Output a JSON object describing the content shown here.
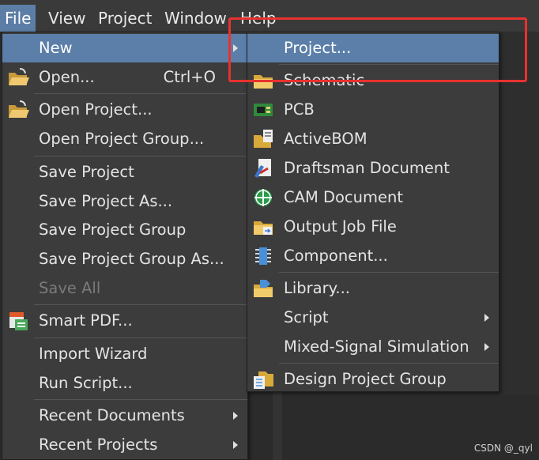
{
  "menubar": {
    "file": "File",
    "view": "View",
    "project": "Project",
    "window": "Window",
    "help": "Help"
  },
  "file_menu": {
    "new": "New",
    "open": "Open...",
    "open_shortcut": "Ctrl+O",
    "open_project": "Open Project...",
    "open_project_group": "Open Project Group...",
    "save_project": "Save Project",
    "save_project_as": "Save Project As...",
    "save_project_group": "Save Project Group",
    "save_project_group_as": "Save Project Group As...",
    "save_all": "Save All",
    "smart_pdf": "Smart PDF...",
    "import_wizard": "Import Wizard",
    "run_script": "Run Script...",
    "recent_documents": "Recent Documents",
    "recent_projects": "Recent Projects"
  },
  "new_menu": {
    "project": "Project...",
    "schematic": "Schematic",
    "pcb": "PCB",
    "activebom": "ActiveBOM",
    "draftsman": "Draftsman Document",
    "cam": "CAM Document",
    "output_job": "Output Job File",
    "component": "Component...",
    "library": "Library...",
    "script": "Script",
    "mixed_signal": "Mixed-Signal Simulation",
    "design_project_group": "Design Project Group"
  },
  "watermark": "CSDN @_qyl",
  "colors": {
    "highlight": "#5b7fa8",
    "menu_bg": "#3c3c3c",
    "annotation_red": "#e8322f"
  }
}
